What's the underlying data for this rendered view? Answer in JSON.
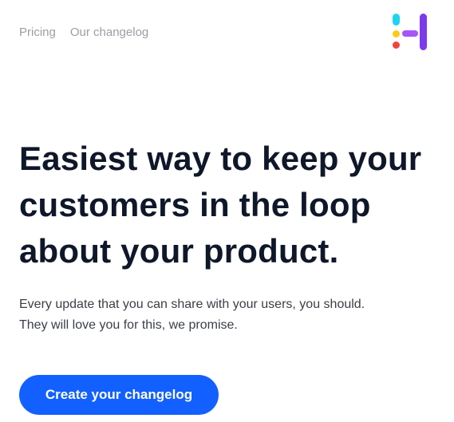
{
  "nav": {
    "items": [
      {
        "label": "Pricing"
      },
      {
        "label": "Our changelog"
      }
    ]
  },
  "logo": {
    "colors": {
      "cyan": "#22d3ee",
      "yellow": "#facc15",
      "red": "#ef4444",
      "violet": "#a855f7",
      "purple": "#7c3aed"
    }
  },
  "hero": {
    "title_lines": [
      "Easiest way to keep your",
      "customers in the loop",
      "about your product."
    ],
    "subtitle_lines": [
      "Every update that you can share with your users, you should.",
      "They will love you for this, we promise."
    ],
    "cta_label": "Create your changelog"
  },
  "colors": {
    "accent": "#1260ff",
    "heading": "#0f172a",
    "body_text": "#3a3f47",
    "nav_text": "#9a9ea6"
  }
}
